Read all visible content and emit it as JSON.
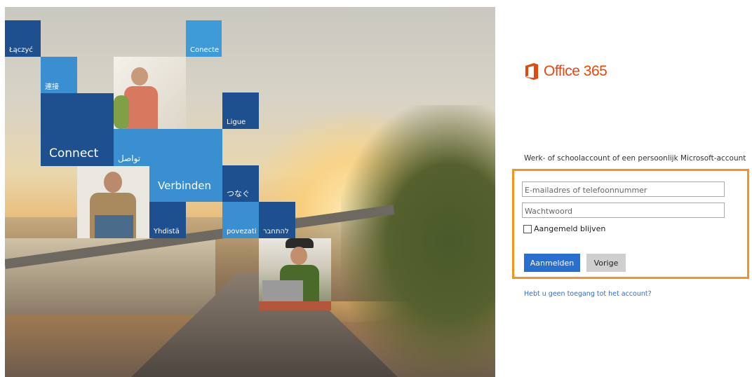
{
  "hero": {
    "tiles": {
      "laczyc": "Łączyć",
      "lianjie": "連接",
      "conecte": "Conecte",
      "connect": "Connect",
      "tawasal": "تواصل",
      "ligue": "Ligue",
      "verbinden": "Verbinden",
      "tsunagu": "つなぐ",
      "yhdista": "Yhdistä",
      "povezati": "povezati",
      "lehitchaber": "להתחבר"
    }
  },
  "brand": {
    "logo_text": "Office 365",
    "accent": "#e8470c",
    "icon": "office-logo-icon"
  },
  "signin": {
    "account_description": "Werk- of schoolaccount of een persoonlijk Microsoft-account",
    "email_placeholder": "E-mailadres of telefoonnummer",
    "password_placeholder": "Wachtwoord",
    "keep_signed_in_label": "Aangemeld blijven",
    "keep_signed_in_checked": false,
    "signin_button": "Aanmelden",
    "back_button": "Vorige",
    "no_access_link": "Hebt u geen toegang tot het account?",
    "highlight_color": "#f5931f",
    "primary_button_color": "#2a6fcf"
  }
}
